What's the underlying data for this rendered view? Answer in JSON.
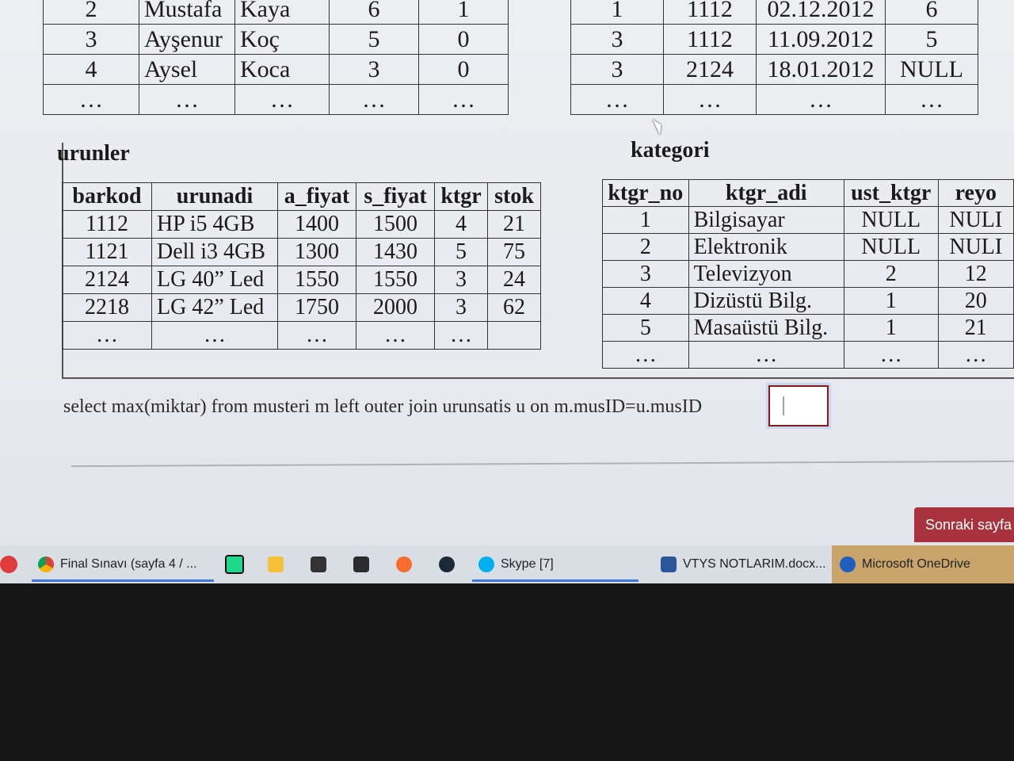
{
  "tables": {
    "top_left": {
      "rows": [
        [
          "2",
          "Mustafa",
          "Kaya",
          "6",
          "1"
        ],
        [
          "3",
          "Ayşenur",
          "Koç",
          "5",
          "0"
        ],
        [
          "4",
          "Aysel",
          "Koca",
          "3",
          "0"
        ],
        [
          "…",
          "…",
          "…",
          "…",
          "…"
        ]
      ]
    },
    "top_right": {
      "rows": [
        [
          "1",
          "1112",
          "02.12.2012",
          "6"
        ],
        [
          "3",
          "1112",
          "11.09.2012",
          "5"
        ],
        [
          "3",
          "2124",
          "18.01.2012",
          "NULL"
        ],
        [
          "…",
          "…",
          "…",
          "…"
        ]
      ]
    },
    "urunler": {
      "caption": "urunler",
      "headers": [
        "barkod",
        "urunadi",
        "a_fiyat",
        "s_fiyat",
        "ktgr",
        "stok"
      ],
      "rows": [
        [
          "1112",
          "HP i5 4GB",
          "1400",
          "1500",
          "4",
          "21"
        ],
        [
          "1121",
          "Dell i3 4GB",
          "1300",
          "1430",
          "5",
          "75"
        ],
        [
          "2124",
          "LG 40” Led",
          "1550",
          "1550",
          "3",
          "24"
        ],
        [
          "2218",
          "LG 42” Led",
          "1750",
          "2000",
          "3",
          "62"
        ],
        [
          "…",
          "…",
          "…",
          "…",
          "…",
          ""
        ]
      ]
    },
    "kategori": {
      "caption": "kategori",
      "headers": [
        "ktgr_no",
        "ktgr_adi",
        "ust_ktgr",
        "reyo"
      ],
      "rows": [
        [
          "1",
          "Bilgisayar",
          "NULL",
          "NULI"
        ],
        [
          "2",
          "Elektronik",
          "NULL",
          "NULI"
        ],
        [
          "3",
          "Televizyon",
          "2",
          "12"
        ],
        [
          "4",
          "Dizüstü Bilg.",
          "1",
          "20"
        ],
        [
          "5",
          "Masaüstü Bilg.",
          "1",
          "21"
        ],
        [
          "…",
          "…",
          "…",
          "…"
        ]
      ]
    }
  },
  "question": {
    "text": "select max(miktar) from musteri m left outer join urunsatis u on m.musID=u.musID",
    "answer_value": ""
  },
  "next_button": {
    "label": "Sonraki sayfa"
  },
  "taskbar": {
    "items": [
      {
        "label": "Final Sınavı (sayfa 4 / ...",
        "icon": "chrome-icon",
        "active": true
      },
      {
        "label": "",
        "icon": "pycharm-icon"
      },
      {
        "label": "",
        "icon": "file-explorer-icon"
      },
      {
        "label": "",
        "icon": "store-icon"
      },
      {
        "label": "",
        "icon": "epic-games-icon"
      },
      {
        "label": "",
        "icon": "origin-icon"
      },
      {
        "label": "",
        "icon": "steam-icon"
      },
      {
        "label": "Skype [7]",
        "icon": "skype-icon",
        "active": true
      },
      {
        "label": "VTYS NOTLARIM.docx...",
        "icon": "word-icon"
      },
      {
        "label": "Microsoft OneDrive",
        "icon": "onedrive-icon"
      }
    ]
  }
}
